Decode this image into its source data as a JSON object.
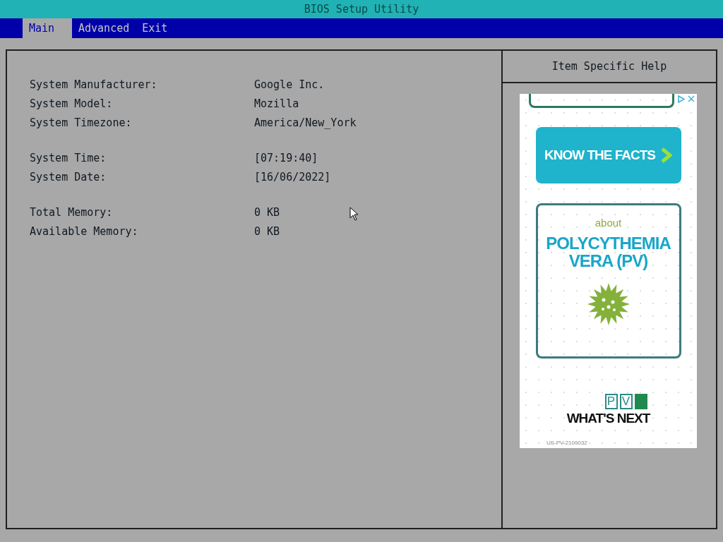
{
  "window": {
    "title": "BIOS Setup Utility"
  },
  "tabs": [
    {
      "label": "Main",
      "selected": true
    },
    {
      "label": "Advanced",
      "selected": false
    },
    {
      "label": "Exit",
      "selected": false
    }
  ],
  "info_groups": [
    [
      {
        "label": "System Manufacturer:",
        "value": "Google Inc."
      },
      {
        "label": "System Model:",
        "value": "Mozilla"
      },
      {
        "label": "System Timezone:",
        "value": "America/New_York"
      }
    ],
    [
      {
        "label": "System Time:",
        "value": "[07:19:40]"
      },
      {
        "label": "System Date:",
        "value": "[16/06/2022]"
      }
    ],
    [
      {
        "label": "Total Memory:",
        "value": "0 KB"
      },
      {
        "label": "Available Memory:",
        "value": "0 KB"
      }
    ]
  ],
  "help_panel": {
    "title": "Item Specific Help",
    "ad": {
      "button": "KNOW THE FACTS",
      "about": "about",
      "headline": "POLYCYTHEMIA VERA (PV)",
      "logo_letters": [
        "P",
        "V"
      ],
      "tagline": "WHAT'S NEXT",
      "code": "US-PV-2100032"
    }
  }
}
